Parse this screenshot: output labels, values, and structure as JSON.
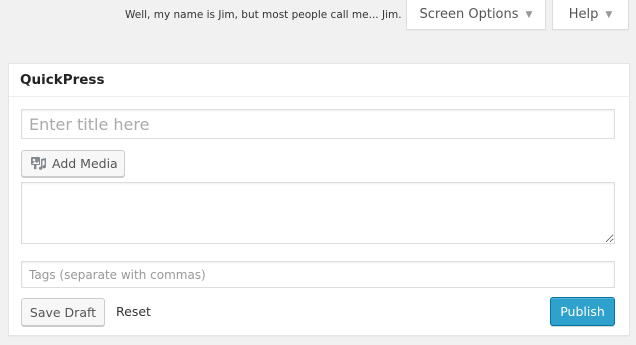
{
  "header": {
    "greeting": "Well, my name is Jim, but most people call me... Jim.",
    "screen_options_label": "Screen Options",
    "help_label": "Help",
    "dropdown_arrow": "▼"
  },
  "quickpress": {
    "title": "QuickPress",
    "title_placeholder": "Enter title here",
    "title_value": "",
    "add_media_label": "Add Media",
    "add_media_icon": "media-icon",
    "content_value": "",
    "tags_placeholder": "Tags (separate with commas)",
    "tags_value": "",
    "save_draft_label": "Save Draft",
    "reset_label": "Reset",
    "publish_label": "Publish"
  },
  "colors": {
    "background": "#f1f1f1",
    "primary_button": "#2ea2cc",
    "primary_border": "#0074a2"
  }
}
